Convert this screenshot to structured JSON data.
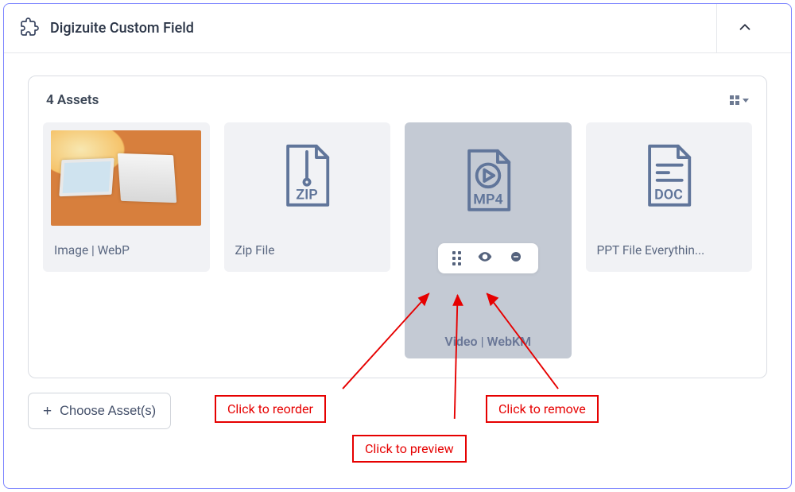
{
  "header": {
    "title": "Digizuite Custom Field"
  },
  "panel": {
    "title": "4 Assets"
  },
  "assets": [
    {
      "label": "Image | WebP",
      "type": "photo"
    },
    {
      "label": "Zip File",
      "type": "zip"
    },
    {
      "label": "Video | WebKM",
      "type": "mp4"
    },
    {
      "label": "PPT File Everythin...",
      "type": "doc"
    }
  ],
  "filetags": {
    "zip": "ZIP",
    "mp4": "MP4",
    "doc": "DOC"
  },
  "choose_btn_label": "Choose Asset(s)",
  "annotations": {
    "reorder": "Click to reorder",
    "preview": "Click to preview",
    "remove": "Click to remove"
  }
}
